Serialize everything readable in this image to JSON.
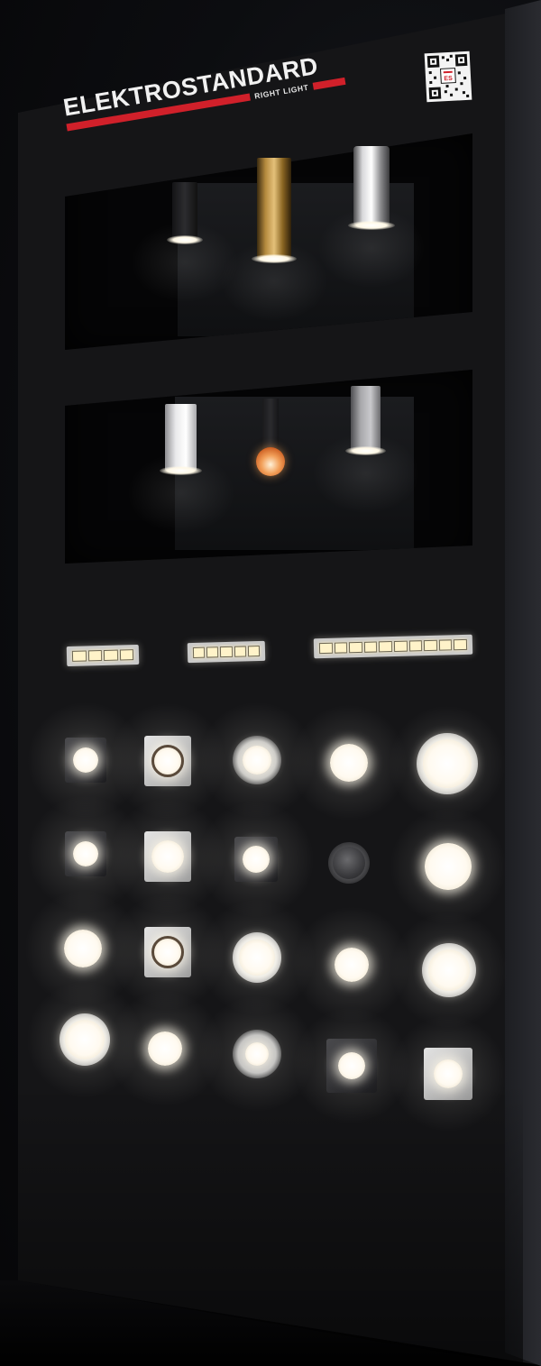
{
  "brand": {
    "name": "ELEKTROSTANDARD",
    "tagline": "RIGHT LIGHT",
    "accent_color": "#d0202a"
  },
  "qr": {
    "label": "ES",
    "icon": "qr-code-icon"
  },
  "scene": {
    "background_color": "#0c0d10",
    "stand_color": "#151517"
  }
}
